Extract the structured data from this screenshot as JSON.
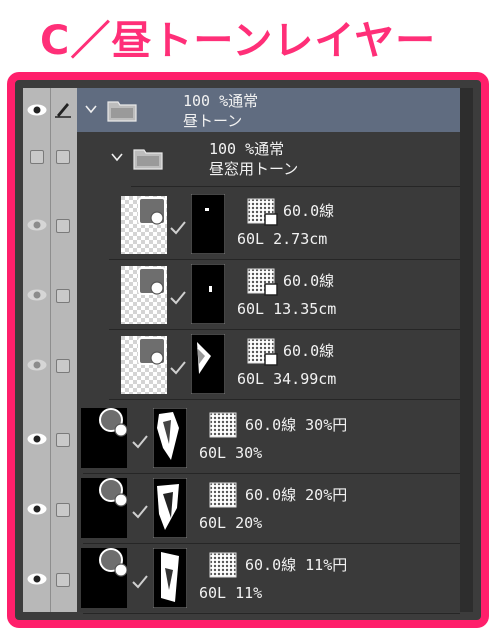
{
  "title": "C／昼トーンレイヤー",
  "colors": {
    "accent": "#ff1f6b",
    "selected": "#606c80",
    "panel": "#3a3a3a"
  },
  "folders": [
    {
      "opacity": "100 %通常",
      "name": "昼トーン",
      "selected": true
    },
    {
      "opacity": "100 %通常",
      "name": "昼窓用トーン",
      "selected": false
    }
  ],
  "layers": [
    {
      "tone": "60.0線",
      "name": "60L 2.73cm"
    },
    {
      "tone": "60.0線",
      "name": "60L 13.35cm"
    },
    {
      "tone": "60.0線",
      "name": "60L 34.99cm"
    },
    {
      "tone": "60.0線 30%円",
      "name": "60L 30%"
    },
    {
      "tone": "60.0線 20%円",
      "name": "60L 20%"
    },
    {
      "tone": "60.0線 11%円",
      "name": "60L 11%"
    }
  ],
  "icons": [
    "eye-icon",
    "pen-icon",
    "chevron-down-icon",
    "folder-icon",
    "mask-link-icon",
    "tone-icon"
  ]
}
